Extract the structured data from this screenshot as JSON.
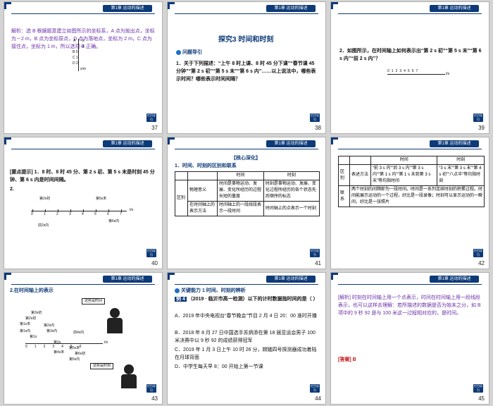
{
  "header_tag": "第1章  运动的描述",
  "back_label": "栏目导引",
  "slides": [
    {
      "page": "37",
      "text1": "解析：选 B 根据题意建立如图所示的坐标系，A 点为抛出点，坐标为－2 m，B 点为坐标原点，D 点为落地点，坐标为 2 m，C 点为接住点，坐标为 1 m，所以选项 B 正确。",
      "axis_labels": [
        "A",
        "−2",
        "−1",
        "B 0",
        "C 1",
        "D 2",
        "x/m"
      ]
    },
    {
      "page": "38",
      "title": "探究3  时间和时刻",
      "guide": "问题导引",
      "q1": "1．关于下列描述：“上午 8 时上课、8 时 45 分下课”“春节课 45 分钟”“第 2 s 初”“第 5 s 末”“第 6 s 内”……以上说法中，哪些表示时间？哪些表示时间间隔？"
    },
    {
      "page": "39",
      "q2": "2．如图所示，在时间轴上如何表示出“第 2 s 初”“第 5 s 末”“第 6 s 内”“前 2 s 内”？",
      "ticks": [
        "0",
        "1",
        "2",
        "3",
        "4",
        "5",
        "6",
        "7",
        "t/s"
      ]
    },
    {
      "page": "40",
      "hint": "[要点提示]  1．8 时、8 时 45 分、第 2 s 初、第 5 s 末是时刻 45 分钟、第 6 s 内是时间间隔。",
      "n2": "2.",
      "lbl_2s_start": "第2s初",
      "lbl_5s_end": "第5s末",
      "lbl_front2": "前2s内",
      "lbl_6s_in": "第6s内",
      "ticks": [
        "0",
        "1",
        "2",
        "3",
        "4",
        "5",
        "6",
        "7",
        "t/s"
      ]
    },
    {
      "page": "41",
      "title": "【核心深化】",
      "sub": "1．时间、时刻的区别和联系",
      "col_time": "时间",
      "col_moment": "时刻",
      "row_group": "区别",
      "row1_label": "物理意义",
      "row1_time": "时间是事物运动、发展、变化所经历的过程长短的量度",
      "row1_moment": "时刻是事物运动、发展、变化过程所经历的各个状态先后顺序的标志",
      "row2_label": "在时间轴上的表示方法",
      "row2_time": "时间轴上的一段线段表示一段时间",
      "row2_moment": "时间轴上的点表示一个时刻"
    },
    {
      "page": "42",
      "col_time": "时间",
      "col_moment": "时刻",
      "row_group": "区别",
      "row_label": "表述方法",
      "row_time": "“前 3 s 内”“后 3 s 内”“第 3 s 内”“第 1 s 内”“第 1 s 末到第 3 s 末”等均指时间",
      "row_moment": "“3 s 末”“第 3 s 末”“第 4 s 初”“八点半”等均指时刻",
      "link_label": "联系",
      "link_text": "两个时刻的间隔即为一段时间。时间是一系列连续时刻的积累过程。时间能展示运动的一个过程，好比是一段录像；时刻可以显示运动的一瞬间，好比是一张照片"
    },
    {
      "page": "43",
      "title": "2.在时间轴上的表示",
      "bubble1": "这些是时间",
      "bubble2": "这些是时刻",
      "labels": [
        "第3s初",
        "第2s初",
        "第1s末",
        "第1s内",
        "第2s内",
        "第3s内",
        "第1s",
        "第2s",
        "前4s内",
        "第5s末",
        "第4s末",
        "第6s初",
        "第5s内"
      ],
      "ticks": [
        "0",
        "1",
        "2",
        "3",
        "4",
        "5",
        "6",
        "t/s"
      ]
    },
    {
      "page": "44",
      "kw": "关键能力 1  时间、时刻的辨析",
      "example": "例 4",
      "q": "（2019 · 临沂市高一检测）以下的计时数据指时间的是（    ）",
      "opt_a": "A．2019 年中央电视台“春节晚会”节目 2 月 4 日 20：00 准时开播",
      "opt_b": "B．2018 年 8 月 27 日中国选手苏炳添在第 18 届亚运会男子 100 米决赛中以 9 秒 92 的成绩获得冠军",
      "opt_c": "C．2019 年 1 月 3 日上午 10 时 26 分，嫦娥四号探测器成功着陆在月球背面",
      "opt_d": "D．中学生每天早 8：00 开始上第一节课"
    },
    {
      "page": "45",
      "analysis": "[解析]  时刻在时间轴上用一个点表示，时间在时间轴上用一段线段表示，也可以这样去理解：若所描述的数据是否为始末之分，如 B 项中的 9 秒 92 是与 100 米这一过程相对应的，是时间。",
      "answer_label": "[答案]",
      "answer": "B"
    }
  ]
}
